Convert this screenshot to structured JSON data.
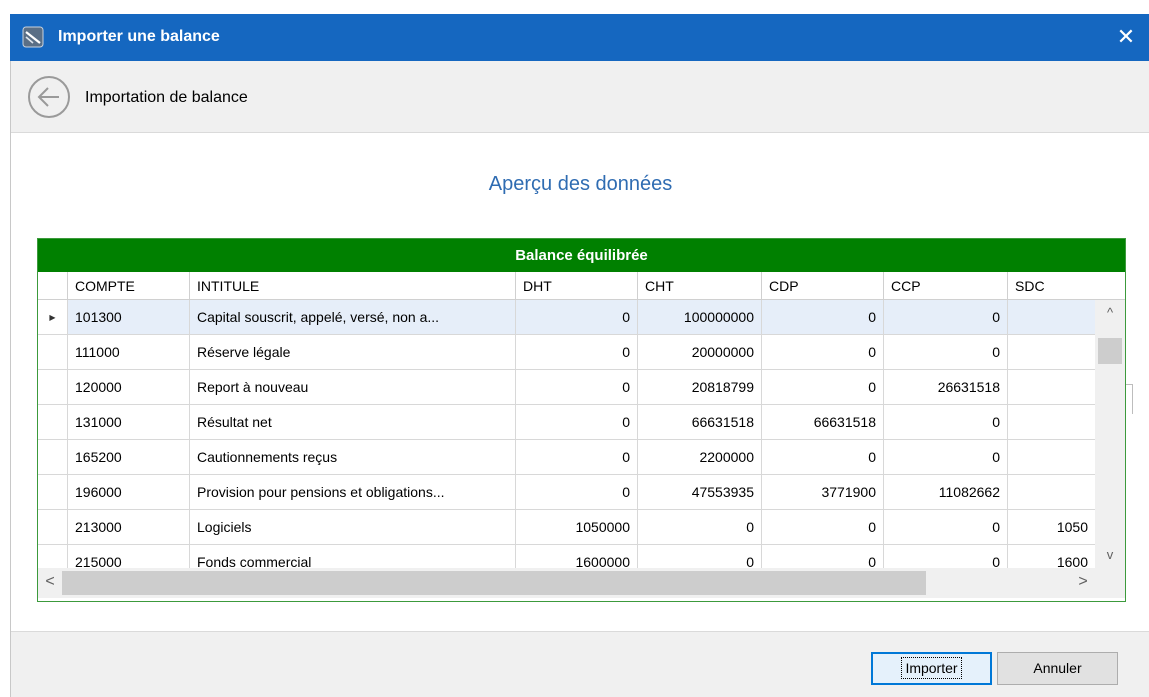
{
  "window": {
    "title": "Importer une balance",
    "close_label": "✕",
    "app_icon": "app-logo-icon",
    "titlebar_color": "#1567c0"
  },
  "subheader": {
    "back_icon": "back-arrow-icon",
    "title": "Importation de balance"
  },
  "main": {
    "heading": "Aperçu des données",
    "heading_color": "#2f6cb2"
  },
  "grid": {
    "banner": "Balance équilibrée",
    "banner_color": "#008000",
    "columns": [
      "COMPTE",
      "INTITULE",
      "DHT",
      "CHT",
      "CDP",
      "CCP",
      "SDC"
    ],
    "rows": [
      {
        "compte": "101300",
        "intitule": "Capital souscrit, appelé, versé, non a...",
        "dht": "0",
        "cht": "100000000",
        "cdp": "0",
        "ccp": "0",
        "sdc": ""
      },
      {
        "compte": "111000",
        "intitule": "Réserve légale",
        "dht": "0",
        "cht": "20000000",
        "cdp": "0",
        "ccp": "0",
        "sdc": ""
      },
      {
        "compte": "120000",
        "intitule": "Report à nouveau",
        "dht": "0",
        "cht": "20818799",
        "cdp": "0",
        "ccp": "26631518",
        "sdc": ""
      },
      {
        "compte": "131000",
        "intitule": "Résultat net",
        "dht": "0",
        "cht": "66631518",
        "cdp": "66631518",
        "ccp": "0",
        "sdc": ""
      },
      {
        "compte": "165200",
        "intitule": "Cautionnements reçus",
        "dht": "0",
        "cht": "2200000",
        "cdp": "0",
        "ccp": "0",
        "sdc": ""
      },
      {
        "compte": "196000",
        "intitule": "Provision pour pensions et obligations...",
        "dht": "0",
        "cht": "47553935",
        "cdp": "3771900",
        "ccp": "11082662",
        "sdc": ""
      },
      {
        "compte": "213000",
        "intitule": "Logiciels",
        "dht": "1050000",
        "cht": "0",
        "cdp": "0",
        "ccp": "0",
        "sdc": "1050"
      },
      {
        "compte": "215000",
        "intitule": "Fonds commercial",
        "dht": "1600000",
        "cht": "0",
        "cdp": "0",
        "ccp": "0",
        "sdc": "1600"
      }
    ],
    "row_indicator": "▶",
    "scroll_up": "^",
    "scroll_down": "v",
    "scroll_left": "<",
    "scroll_right": ">"
  },
  "footer": {
    "import_label": "Importer",
    "cancel_label": "Annuler"
  }
}
